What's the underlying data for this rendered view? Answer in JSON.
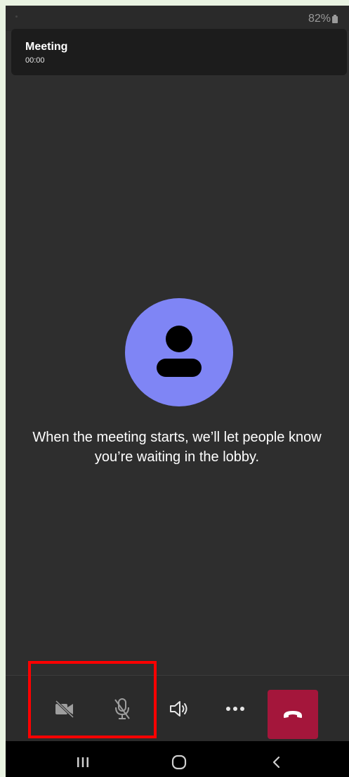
{
  "status_bar": {
    "battery": "82%"
  },
  "meeting": {
    "title": "Meeting",
    "duration": "00:00"
  },
  "lobby": {
    "message": "When the meeting starts, we’ll let people know you’re waiting in the lobby."
  },
  "toolbar": {
    "buttons": [
      {
        "name": "camera-off",
        "icon": "video-off-icon"
      },
      {
        "name": "mic-muted",
        "icon": "mic-off-icon"
      },
      {
        "name": "speaker",
        "icon": "speaker-icon"
      },
      {
        "name": "more-options",
        "icon": "more-dots-icon"
      },
      {
        "name": "leave",
        "icon": "hang-up-icon"
      }
    ],
    "hangup_color": "#a4163b"
  },
  "avatar": {
    "color": "#7f85f5",
    "icon": "person-icon"
  },
  "highlight_color": "#ff0000",
  "nav": {
    "buttons": [
      "recents-icon",
      "home-icon",
      "back-icon"
    ]
  }
}
